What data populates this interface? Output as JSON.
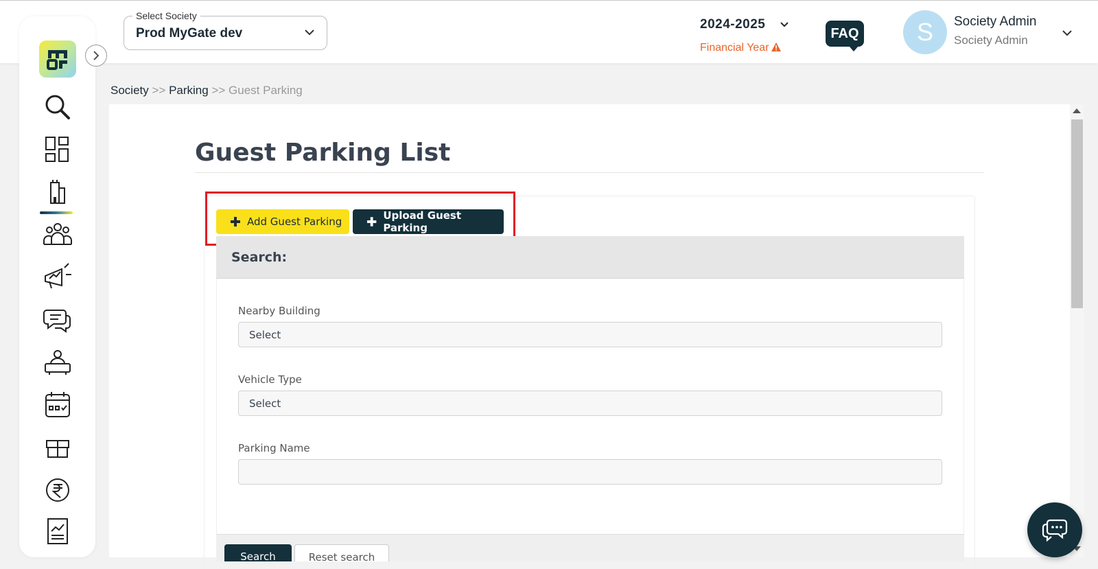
{
  "header": {
    "society_select": {
      "legend": "Select Society",
      "value": "Prod MyGate dev"
    },
    "financial_year": {
      "year": "2024-2025",
      "label": "Financial Year"
    },
    "faq_label": "FAQ",
    "user": {
      "initial": "S",
      "name": "Society Admin",
      "role": "Society Admin"
    }
  },
  "sidebar": {
    "items": [
      {
        "icon": "search-icon"
      },
      {
        "icon": "dashboard-icon"
      },
      {
        "icon": "building-icon",
        "active": true
      },
      {
        "icon": "people-icon"
      },
      {
        "icon": "megaphone-icon"
      },
      {
        "icon": "chat-icon"
      },
      {
        "icon": "helpdesk-icon"
      },
      {
        "icon": "calendar-icon"
      },
      {
        "icon": "package-icon"
      },
      {
        "icon": "rupee-icon"
      },
      {
        "icon": "report-icon"
      }
    ]
  },
  "breadcrumb": {
    "items": [
      "Society",
      "Parking",
      "Guest Parking"
    ],
    "separator": ">>"
  },
  "page": {
    "title": "Guest Parking List",
    "add_button": "Add Guest Parking",
    "upload_button": "Upload Guest Parking",
    "search_heading": "Search:",
    "fields": {
      "nearby_building": {
        "label": "Nearby Building",
        "value": "Select"
      },
      "vehicle_type": {
        "label": "Vehicle Type",
        "value": "Select"
      },
      "parking_name": {
        "label": "Parking Name",
        "value": ""
      }
    },
    "search_button": "Search",
    "reset_button": "Reset search"
  },
  "colors": {
    "primary_dark": "#13303b",
    "accent_yellow": "#f9e01b",
    "warning_orange": "#e8652b",
    "highlight_red": "#e01b24"
  }
}
